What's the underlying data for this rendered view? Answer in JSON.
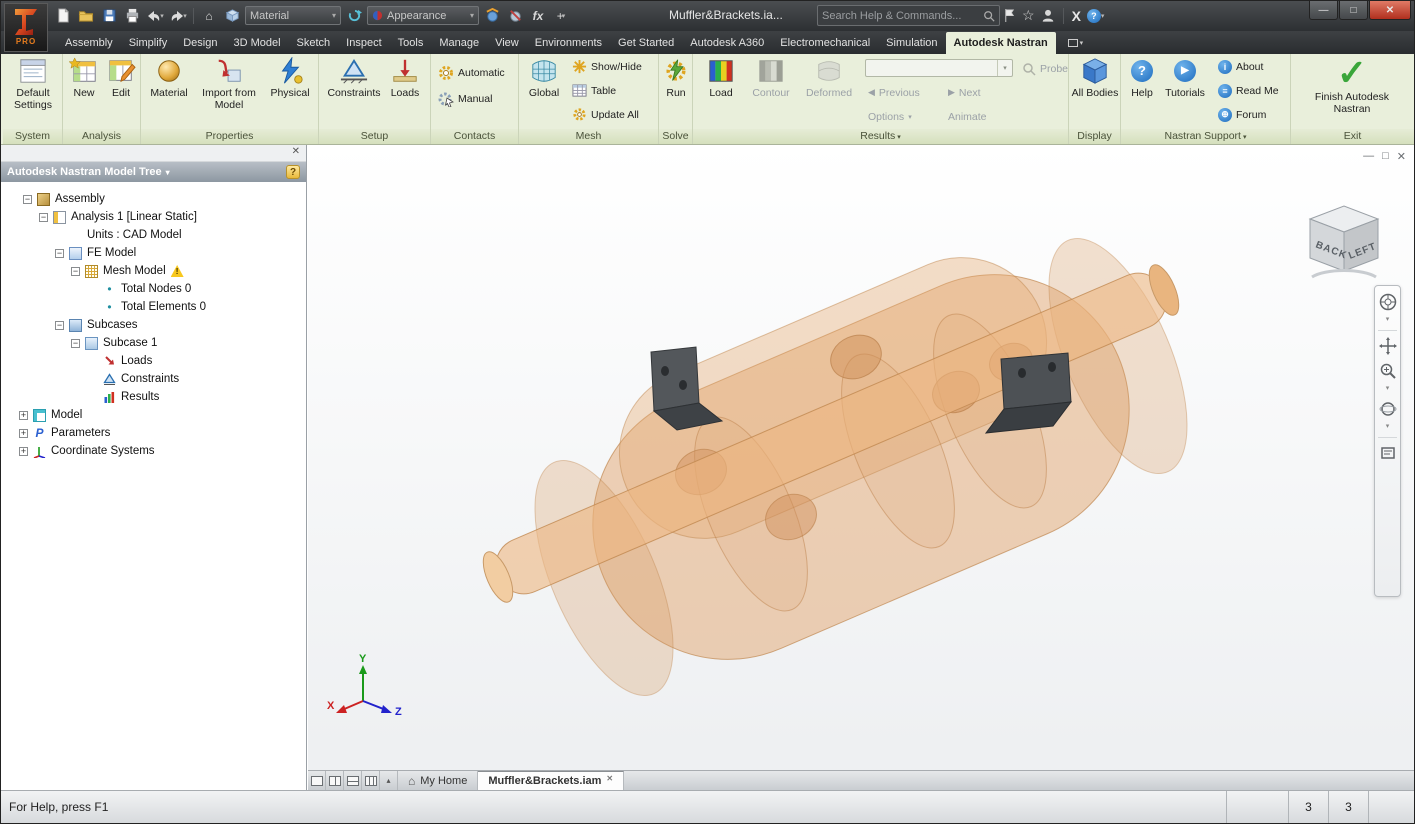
{
  "titlebar": {
    "title": "Muffler&Brackets.ia...",
    "search_placeholder": "Search Help & Commands...",
    "logo_text": "PRO"
  },
  "qat": {
    "material_value": "Material",
    "appearance_value": "Appearance"
  },
  "glyphs": {
    "chevron_down": "▾",
    "chevron_up": "▴",
    "minus": "−",
    "plus": "+",
    "close": "✕",
    "win_minimize": "—",
    "win_maximize": "□",
    "check": "✓",
    "question": "?",
    "info": "i",
    "prev": "◀",
    "next": "▶",
    "bullet": "•",
    "warning": "!",
    "home": "⌂",
    "star": "☆",
    "fx": "fx",
    "exchange_x": "X",
    "param_p": "P",
    "forum_globe": "⊕",
    "readme_lines": "≡",
    "tutorial_play": "▶"
  },
  "tabs": [
    "Assembly",
    "Simplify",
    "Design",
    "3D Model",
    "Sketch",
    "Inspect",
    "Tools",
    "Manage",
    "View",
    "Environments",
    "Get Started",
    "Autodesk A360",
    "Electromechanical",
    "Simulation",
    "Autodesk Nastran"
  ],
  "ribbon": {
    "system": {
      "title": "System",
      "default_settings": "Default Settings"
    },
    "analysis": {
      "title": "Analysis",
      "new": "New",
      "edit": "Edit"
    },
    "properties": {
      "title": "Properties",
      "material": "Material",
      "import_from_model": "Import from Model",
      "physical": "Physical"
    },
    "setup": {
      "title": "Setup",
      "constraints": "Constraints",
      "loads": "Loads"
    },
    "contacts": {
      "title": "Contacts",
      "automatic": "Automatic",
      "manual": "Manual"
    },
    "mesh": {
      "title": "Mesh",
      "global": "Global",
      "show_hide": "Show/Hide",
      "table": "Table",
      "update_all": "Update All"
    },
    "solve": {
      "title": "Solve",
      "run": "Run"
    },
    "results": {
      "title": "Results",
      "load": "Load",
      "contour": "Contour",
      "deformed": "Deformed",
      "previous": "Previous",
      "next": "Next",
      "options": "Options",
      "animate": "Animate",
      "probe": "Probe"
    },
    "display": {
      "title": "Display",
      "all_bodies": "All Bodies"
    },
    "support": {
      "title": "Nastran Support",
      "help": "Help",
      "tutorials": "Tutorials",
      "about": "About",
      "read_me": "Read Me",
      "forum": "Forum"
    },
    "exit": {
      "title": "Exit",
      "finish": "Finish Autodesk Nastran"
    }
  },
  "tree": {
    "title": "Autodesk Nastran Model Tree",
    "items": [
      {
        "label": "Assembly",
        "icon": "assembly-icon"
      },
      {
        "label": "Analysis 1 [Linear Static]",
        "icon": "analysis-icon"
      },
      {
        "label": "Units : CAD Model",
        "icon": ""
      },
      {
        "label": "FE Model",
        "icon": "fe-model-icon"
      },
      {
        "label": "Mesh Model",
        "icon": "mesh-model-icon"
      },
      {
        "label": "Total Nodes 0",
        "icon": "bullet-icon"
      },
      {
        "label": "Total Elements 0",
        "icon": "bullet-icon"
      },
      {
        "label": "Subcases",
        "icon": "subcases-icon"
      },
      {
        "label": "Subcase 1",
        "icon": "subcase-icon"
      },
      {
        "label": "Loads",
        "icon": "loads-icon"
      },
      {
        "label": "Constraints",
        "icon": "constraints-icon"
      },
      {
        "label": "Results",
        "icon": "results-icon"
      },
      {
        "label": "Model",
        "icon": "model-icon"
      },
      {
        "label": "Parameters",
        "icon": "parameters-icon"
      },
      {
        "label": "Coordinate Systems",
        "icon": "coordinate-systems-icon"
      }
    ]
  },
  "viewcube": {
    "back": "BACK",
    "left": "LEFT"
  },
  "axes": {
    "x": "X",
    "y": "Y",
    "z": "Z"
  },
  "doctabs": {
    "my_home": "My Home",
    "document": "Muffler&Brackets.iam"
  },
  "statusbar": {
    "message": "For Help, press F1",
    "value1": "3",
    "value2": "3"
  }
}
